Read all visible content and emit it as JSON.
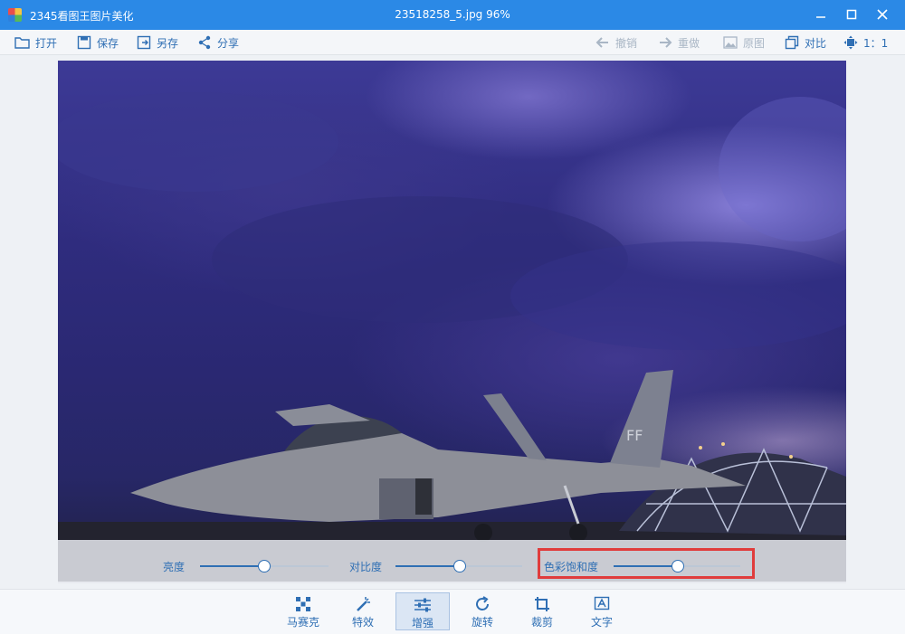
{
  "titlebar": {
    "app_title": "2345看图王图片美化",
    "document_title": "23518258_5.jpg  96%"
  },
  "toolbar": {
    "open": "打开",
    "save": "保存",
    "save_as": "另存",
    "share": "分享",
    "undo": "撤销",
    "redo": "重做",
    "original": "原图",
    "compare": "对比",
    "actual_size": "1：1"
  },
  "adjust": {
    "brightness": {
      "label": "亮度",
      "value": 0.5
    },
    "contrast": {
      "label": "对比度",
      "value": 0.5
    },
    "saturation": {
      "label": "色彩饱和度",
      "value": 0.5
    }
  },
  "tools": [
    {
      "label": "马赛克",
      "icon": "mosaic-icon"
    },
    {
      "label": "特效",
      "icon": "magic-wand-icon"
    },
    {
      "label": "增强",
      "icon": "sliders-icon",
      "active": true
    },
    {
      "label": "旋转",
      "icon": "rotate-icon"
    },
    {
      "label": "裁剪",
      "icon": "crop-icon"
    },
    {
      "label": "文字",
      "icon": "text-icon"
    }
  ],
  "colors": {
    "titlebar": "#2b89e6",
    "accent": "#2f6fb4",
    "highlight": "#e03c3c"
  }
}
